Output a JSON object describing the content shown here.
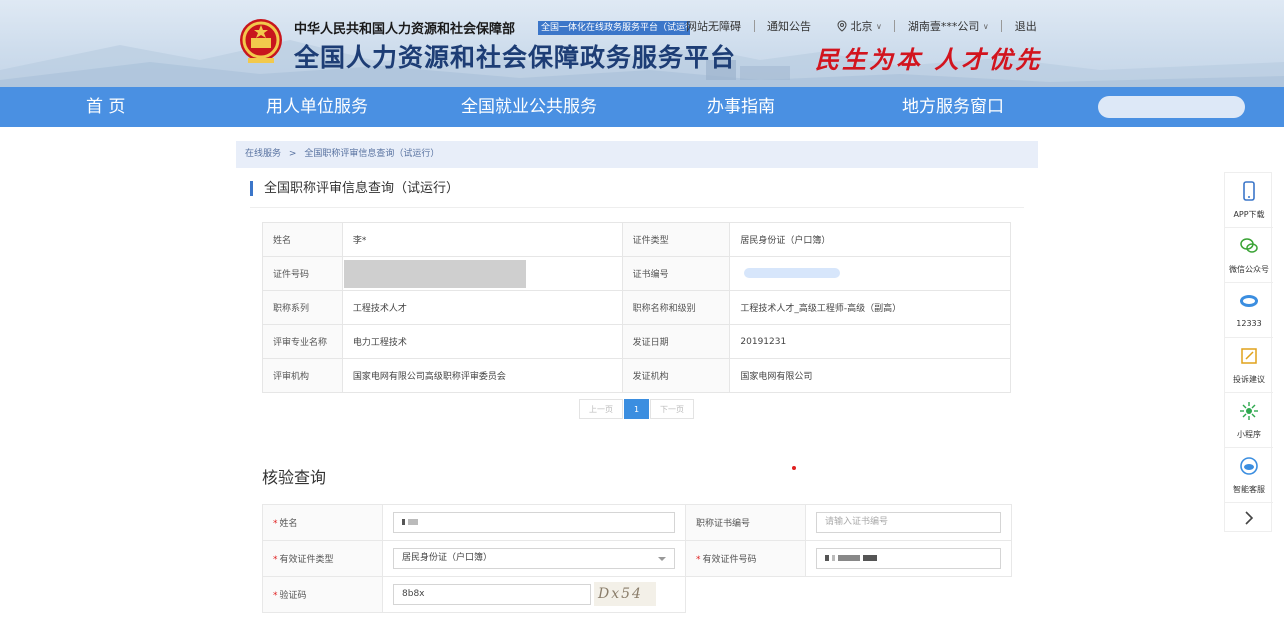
{
  "header": {
    "org_name": "中华人民共和国人力资源和社会保障部",
    "org_tag": "全国一体化在线政务服务平台（试运行）",
    "platform_title": "全国人力资源和社会保障政务服务平台",
    "slogan": "民生为本 人才优先",
    "accessibility": "网站无障碍",
    "notice": "通知公告",
    "location": "北京",
    "company": "湖南壹***公司",
    "logout": "退出"
  },
  "nav": {
    "items": [
      "首 页",
      "用人单位服务",
      "全国就业公共服务",
      "办事指南",
      "地方服务窗口"
    ]
  },
  "breadcrumb": {
    "home": "在线服务",
    "sep": ">",
    "current": "全国职称评审信息查询（试运行）"
  },
  "result": {
    "title": "全国职称评审信息查询（试运行）",
    "rows": [
      {
        "k1": "姓名",
        "v1": "李*",
        "k2": "证件类型",
        "v2": "居民身份证（户口簿）"
      },
      {
        "k1": "证件号码",
        "v1": "",
        "k2": "证书编号",
        "v2": ""
      },
      {
        "k1": "职称系列",
        "v1": "工程技术人才",
        "k2": "职称名称和级别",
        "v2": "工程技术人才_高级工程师-高级（副高）"
      },
      {
        "k1": "评审专业名称",
        "v1": "电力工程技术",
        "k2": "发证日期",
        "v2": "20191231"
      },
      {
        "k1": "评审机构",
        "v1": "国家电网有限公司高级职称评审委员会",
        "k2": "发证机构",
        "v2": "国家电网有限公司"
      }
    ],
    "pager": {
      "prev": "上一页",
      "page": "1",
      "next": "下一页"
    }
  },
  "verify": {
    "title": "核验查询",
    "name_label": "姓名",
    "cert_no_label": "职称证书编号",
    "cert_no_placeholder": "请输入证书编号",
    "id_type_label": "有效证件类型",
    "id_type_value": "居民身份证（户口簿）",
    "id_no_label": "有效证件号码",
    "captcha_label": "验证码",
    "captcha_value": "8b8x",
    "captcha_image": "Dx54",
    "required_mark": "*"
  },
  "sidebar": {
    "items": [
      {
        "label": "APP下载",
        "icon": "phone-icon"
      },
      {
        "label": "微信公众号",
        "icon": "wechat-icon"
      },
      {
        "label": "12333",
        "icon": "hotline-icon"
      },
      {
        "label": "投诉建议",
        "icon": "edit-icon"
      },
      {
        "label": "小程序",
        "icon": "mini-program-icon"
      },
      {
        "label": "智能客服",
        "icon": "headset-icon"
      }
    ]
  },
  "colors": {
    "nav": "#4a90e2",
    "accent": "#3b76c9",
    "slogan": "#d2141e"
  }
}
